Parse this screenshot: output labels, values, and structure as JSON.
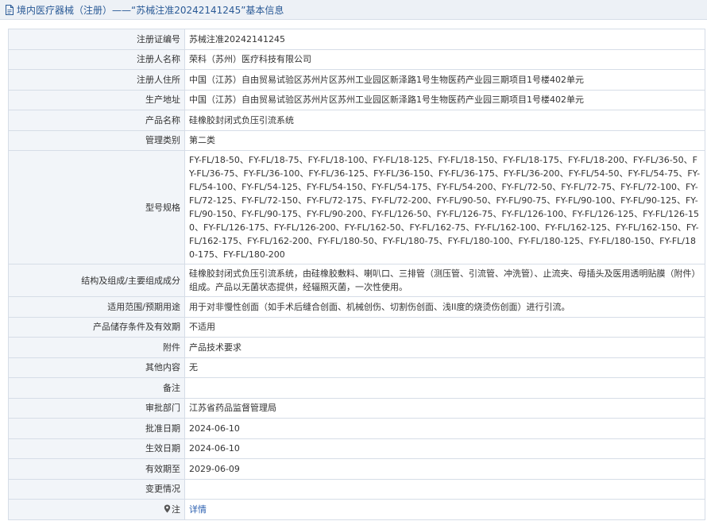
{
  "header": {
    "title": "境内医疗器械（注册）——“苏械注准20242141245”基本信息"
  },
  "rows": [
    {
      "label": "注册证编号",
      "value": "苏械注准20242141245"
    },
    {
      "label": "注册人名称",
      "value": "荣科（苏州）医疗科技有限公司"
    },
    {
      "label": "注册人住所",
      "value": "中国（江苏）自由贸易试验区苏州片区苏州工业园区新泽路1号生物医药产业园三期项目1号楼402单元"
    },
    {
      "label": "生产地址",
      "value": "中国（江苏）自由贸易试验区苏州片区苏州工业园区新泽路1号生物医药产业园三期项目1号楼402单元"
    },
    {
      "label": "产品名称",
      "value": "硅橡胶封闭式负压引流系统"
    },
    {
      "label": "管理类别",
      "value": "第二类"
    },
    {
      "label": "型号规格",
      "value": "FY-FL/18-50、FY-FL/18-75、FY-FL/18-100、FY-FL/18-125、FY-FL/18-150、FY-FL/18-175、FY-FL/18-200、FY-FL/36-50、FY-FL/36-75、FY-FL/36-100、FY-FL/36-125、FY-FL/36-150、FY-FL/36-175、FY-FL/36-200、FY-FL/54-50、FY-FL/54-75、FY-FL/54-100、FY-FL/54-125、FY-FL/54-150、FY-FL/54-175、FY-FL/54-200、FY-FL/72-50、FY-FL/72-75、FY-FL/72-100、FY-FL/72-125、FY-FL/72-150、FY-FL/72-175、FY-FL/72-200、FY-FL/90-50、FY-FL/90-75、FY-FL/90-100、FY-FL/90-125、FY-FL/90-150、FY-FL/90-175、FY-FL/90-200、FY-FL/126-50、FY-FL/126-75、FY-FL/126-100、FY-FL/126-125、FY-FL/126-150、FY-FL/126-175、FY-FL/126-200、FY-FL/162-50、FY-FL/162-75、FY-FL/162-100、FY-FL/162-125、FY-FL/162-150、FY-FL/162-175、FY-FL/162-200、FY-FL/180-50、FY-FL/180-75、FY-FL/180-100、FY-FL/180-125、FY-FL/180-150、FY-FL/180-175、FY-FL/180-200"
    },
    {
      "label": "结构及组成/主要组成成分",
      "value": "硅橡胶封闭式负压引流系统，由硅橡胶敷料、喇叭口、三排管（测压管、引流管、冲洗管）、止流夹、母插头及医用透明贴膜（附件）组成。产品以无菌状态提供，经辐照灭菌，一次性使用。"
    },
    {
      "label": "适用范围/预期用途",
      "value": "用于对非慢性创面（如手术后缝合创面、机械创伤、切割伤创面、浅II度的烧烫伤创面）进行引流。"
    },
    {
      "label": "产品储存条件及有效期",
      "value": "不适用"
    },
    {
      "label": "附件",
      "value": "产品技术要求"
    },
    {
      "label": "其他内容",
      "value": "无"
    },
    {
      "label": "备注",
      "value": ""
    },
    {
      "label": "审批部门",
      "value": "江苏省药品监督管理局"
    },
    {
      "label": "批准日期",
      "value": "2024-06-10"
    },
    {
      "label": "生效日期",
      "value": "2024-06-10"
    },
    {
      "label": "有效期至",
      "value": "2029-06-09"
    },
    {
      "label": "变更情况",
      "value": ""
    }
  ],
  "note_row": {
    "label": "注",
    "link": "详情"
  }
}
